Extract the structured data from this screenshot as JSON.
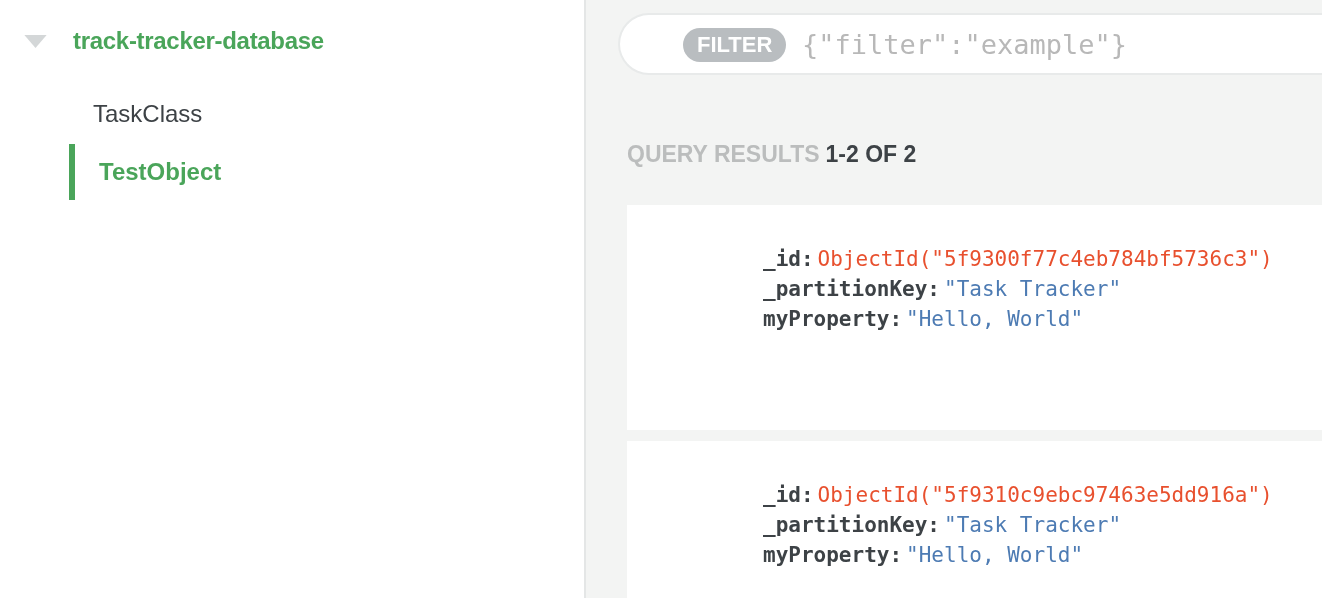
{
  "sidebar": {
    "database": {
      "name": "track-tracker-database",
      "expanded": true
    },
    "items": [
      {
        "label": "TaskClass",
        "selected": false
      },
      {
        "label": "TestObject",
        "selected": true
      }
    ]
  },
  "filter": {
    "badge": "FILTER",
    "placeholder": "{\"filter\":\"example\"}"
  },
  "results": {
    "label": "QUERY RESULTS",
    "count": "1-2 OF 2"
  },
  "documents": [
    {
      "fields": [
        {
          "key": "_id:",
          "value": "ObjectId(\"5f9300f77c4eb784bf5736c3\")",
          "kind": "objectid"
        },
        {
          "key": "_partitionKey:",
          "value": "\"Task Tracker\"",
          "kind": "string"
        },
        {
          "key": "myProperty:",
          "value": "\"Hello, World\"",
          "kind": "string"
        }
      ]
    },
    {
      "fields": [
        {
          "key": "_id:",
          "value": "ObjectId(\"5f9310c9ebc97463e5dd916a\")",
          "kind": "objectid"
        },
        {
          "key": "_partitionKey:",
          "value": "\"Task Tracker\"",
          "kind": "string"
        },
        {
          "key": "myProperty:",
          "value": "\"Hello, World\"",
          "kind": "string"
        }
      ]
    }
  ]
}
